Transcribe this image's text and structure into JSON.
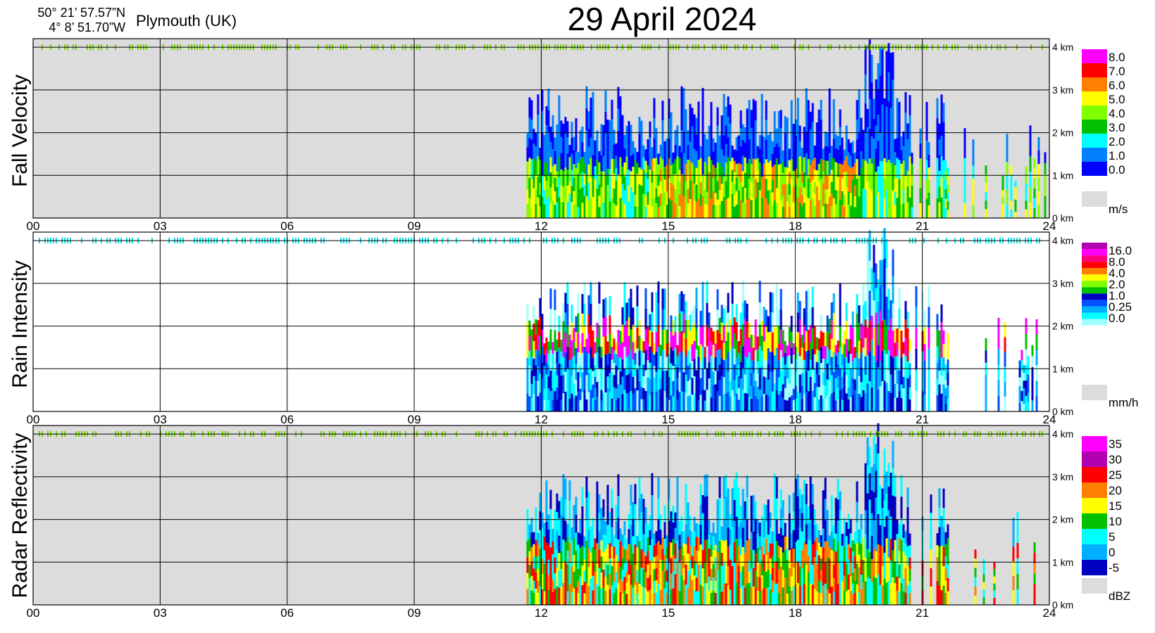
{
  "header": {
    "lat": "50° 21’ 57.57”N",
    "lon": "4°  8’ 51.70”W",
    "place": "Plymouth (UK)",
    "title": "29 April 2024"
  },
  "chart_data": [
    {
      "type": "heatmap",
      "title": "Fall Velocity",
      "xlim": [
        0,
        24
      ],
      "x_ticks": [
        "00",
        "03",
        "06",
        "09",
        "12",
        "15",
        "18",
        "21",
        "24"
      ],
      "ylim": [
        0,
        4.2
      ],
      "y_ticks": [
        "0 km",
        "1 km",
        "2 km",
        "3 km",
        "4 km"
      ],
      "background": "#dcdcdc",
      "colorbar": {
        "unit": "m/s",
        "labels": [
          "8.0",
          "7.0",
          "6.0",
          "5.0",
          "4.0",
          "3.0",
          "2.0",
          "1.0",
          "0.0"
        ],
        "colors": [
          "#ff00ff",
          "#ff0000",
          "#ff8000",
          "#ffff00",
          "#80ff00",
          "#00c000",
          "#00ffff",
          "#0080ff",
          "#0000ff"
        ]
      }
    },
    {
      "type": "heatmap",
      "title": "Rain Intensity",
      "xlim": [
        0,
        24
      ],
      "x_ticks": [
        "00",
        "03",
        "06",
        "09",
        "12",
        "15",
        "18",
        "21",
        "24"
      ],
      "ylim": [
        0,
        4.2
      ],
      "y_ticks": [
        "0 km",
        "1 km",
        "2 km",
        "3 km",
        "4 km"
      ],
      "background": "#ffffff",
      "colorbar": {
        "unit": "mm/h",
        "labels": [
          "16.0",
          "8.0",
          "4.0",
          "2.0",
          "1.0",
          "0.25",
          "0.0"
        ],
        "colors": [
          "#b000b0",
          "#ff00ff",
          "#ff0080",
          "#ff0000",
          "#ff8000",
          "#ffff00",
          "#80ff00",
          "#00c000",
          "#0000c0",
          "#0050ff",
          "#00b0ff",
          "#00ffff",
          "#a0ffff"
        ]
      }
    },
    {
      "type": "heatmap",
      "title": "Radar Reflectivity",
      "xlim": [
        0,
        24
      ],
      "x_ticks": [
        "00",
        "03",
        "06",
        "09",
        "12",
        "15",
        "18",
        "21",
        "24"
      ],
      "ylim": [
        0,
        4.2
      ],
      "y_ticks": [
        "0 km",
        "1 km",
        "2 km",
        "3 km",
        "4 km"
      ],
      "background": "#dcdcdc",
      "colorbar": {
        "unit": "dBZ",
        "labels": [
          "35",
          "30",
          "25",
          "20",
          "15",
          "10",
          "5",
          "0",
          "-5"
        ],
        "colors": [
          "#ff00ff",
          "#b000b0",
          "#ff0000",
          "#ff8000",
          "#ffff00",
          "#00c000",
          "#00ffff",
          "#00b0ff",
          "#0000c0"
        ]
      }
    }
  ]
}
